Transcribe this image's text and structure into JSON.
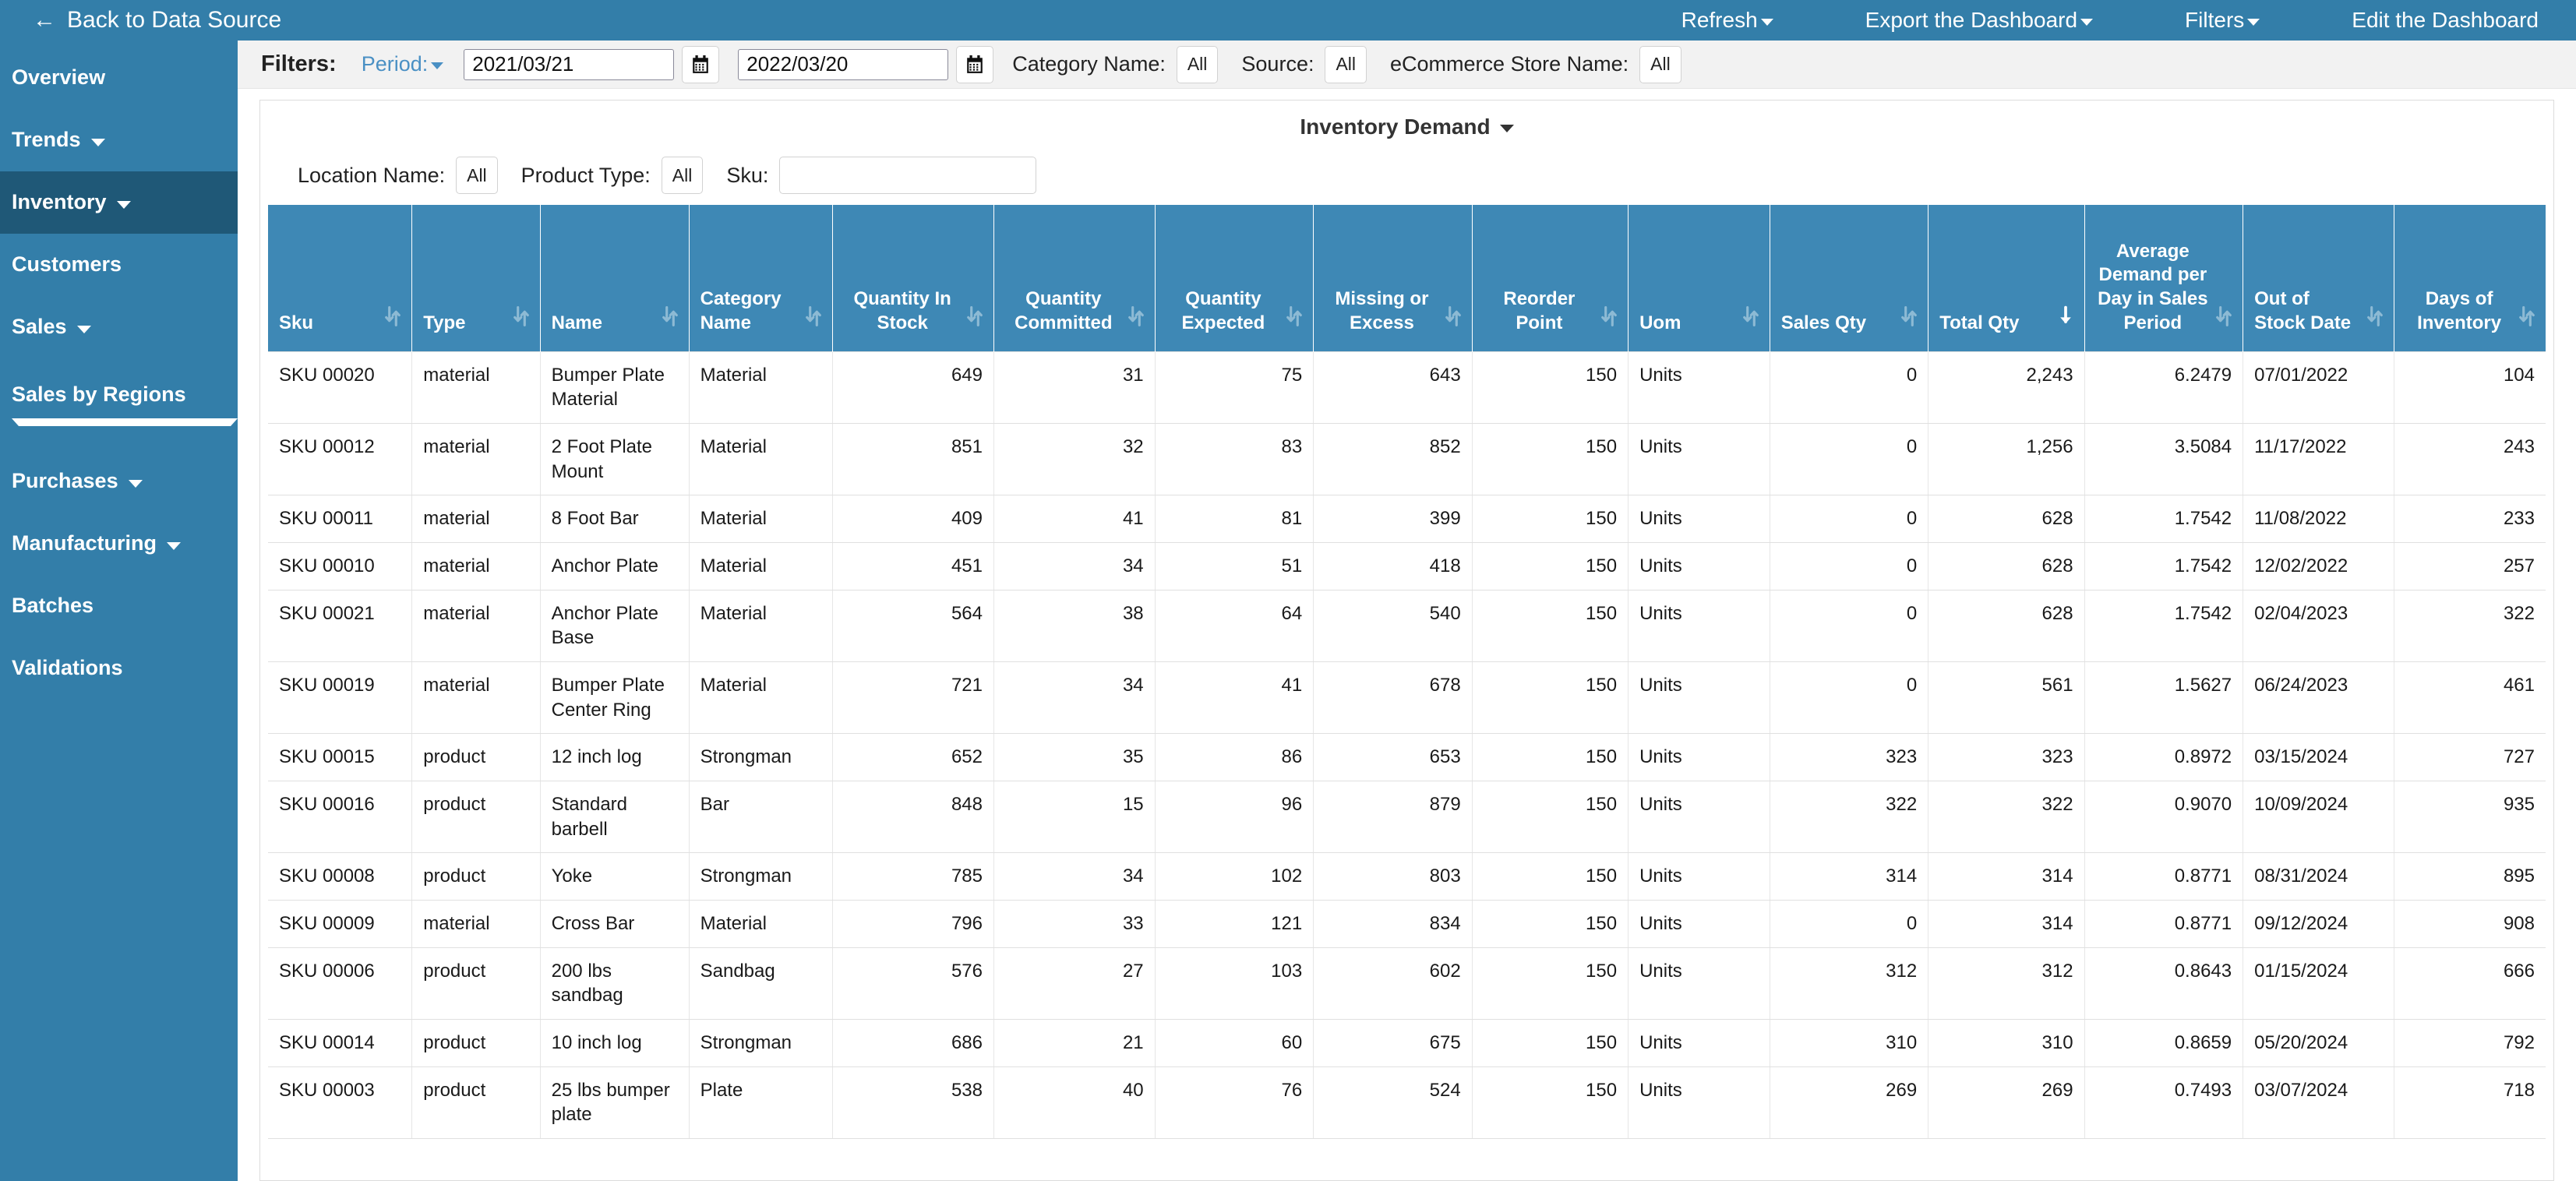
{
  "topbar": {
    "back_label": "Back to Data Source",
    "back_icon": "arrow-left-icon",
    "nav": [
      {
        "label": "Refresh",
        "has_caret": true
      },
      {
        "label": "Export the Dashboard",
        "has_caret": true
      },
      {
        "label": "Filters",
        "has_caret": true
      },
      {
        "label": "Edit the Dashboard",
        "has_caret": false
      }
    ]
  },
  "sidebar": {
    "items": [
      {
        "label": "Overview",
        "caret": false,
        "active": false
      },
      {
        "label": "Trends",
        "caret": true,
        "active": false
      },
      {
        "label": "Inventory",
        "caret": true,
        "active": true
      },
      {
        "label": "Customers",
        "caret": false,
        "active": false
      },
      {
        "label": "Sales",
        "caret": true,
        "active": false
      },
      {
        "label": "Sales by Regions",
        "caret": true,
        "active": false,
        "wrapped": true
      },
      {
        "label": "Purchases",
        "caret": true,
        "active": false
      },
      {
        "label": "Manufacturing",
        "caret": true,
        "active": false
      },
      {
        "label": "Batches",
        "caret": false,
        "active": false
      },
      {
        "label": "Validations",
        "caret": false,
        "active": false
      }
    ]
  },
  "filterbar": {
    "title": "Filters:",
    "period_label": "Period:",
    "date_from": "2021/03/21",
    "date_to": "2022/03/20",
    "calendar_icon": "calendar-icon",
    "category_label": "Category Name:",
    "category_value": "All",
    "source_label": "Source:",
    "source_value": "All",
    "store_label": "eCommerce Store Name:",
    "store_value": "All"
  },
  "panel": {
    "title": "Inventory Demand",
    "location_label": "Location Name:",
    "location_value": "All",
    "product_type_label": "Product Type:",
    "product_type_value": "All",
    "sku_label": "Sku:",
    "sku_value": "",
    "sku_placeholder": ""
  },
  "table": {
    "sort_column": "Total Qty",
    "sort_direction": "desc",
    "columns": [
      {
        "label": "Sku",
        "align": "txt",
        "sorted": false
      },
      {
        "label": "Type",
        "align": "txt",
        "sorted": false
      },
      {
        "label": "Name",
        "align": "txt",
        "sorted": false
      },
      {
        "label": "Category Name",
        "align": "txt",
        "sorted": false
      },
      {
        "label": "Quantity In Stock",
        "align": "num",
        "sorted": false
      },
      {
        "label": "Quantity Committed",
        "align": "num",
        "sorted": false
      },
      {
        "label": "Quantity Expected",
        "align": "num",
        "sorted": false
      },
      {
        "label": "Missing or Excess",
        "align": "num",
        "sorted": false
      },
      {
        "label": "Reorder Point",
        "align": "num",
        "sorted": false
      },
      {
        "label": "Uom",
        "align": "txt",
        "sorted": false
      },
      {
        "label": "Sales Qty",
        "align": "num",
        "sorted": false
      },
      {
        "label": "Total Qty",
        "align": "num",
        "sorted": true
      },
      {
        "label": "Average Demand per Day in Sales Period",
        "align": "num",
        "sorted": false
      },
      {
        "label": "Out of Stock Date",
        "align": "txt",
        "sorted": false
      },
      {
        "label": "Days of Inventory",
        "align": "num",
        "sorted": false
      }
    ],
    "rows": [
      [
        "SKU 00020",
        "material",
        "Bumper Plate Material",
        "Material",
        "649",
        "31",
        "75",
        "643",
        "150",
        "Units",
        "0",
        "2,243",
        "6.2479",
        "07/01/2022",
        "104"
      ],
      [
        "SKU 00012",
        "material",
        "2 Foot Plate Mount",
        "Material",
        "851",
        "32",
        "83",
        "852",
        "150",
        "Units",
        "0",
        "1,256",
        "3.5084",
        "11/17/2022",
        "243"
      ],
      [
        "SKU 00011",
        "material",
        "8 Foot Bar",
        "Material",
        "409",
        "41",
        "81",
        "399",
        "150",
        "Units",
        "0",
        "628",
        "1.7542",
        "11/08/2022",
        "233"
      ],
      [
        "SKU 00010",
        "material",
        "Anchor Plate",
        "Material",
        "451",
        "34",
        "51",
        "418",
        "150",
        "Units",
        "0",
        "628",
        "1.7542",
        "12/02/2022",
        "257"
      ],
      [
        "SKU 00021",
        "material",
        "Anchor Plate Base",
        "Material",
        "564",
        "38",
        "64",
        "540",
        "150",
        "Units",
        "0",
        "628",
        "1.7542",
        "02/04/2023",
        "322"
      ],
      [
        "SKU 00019",
        "material",
        "Bumper Plate Center Ring",
        "Material",
        "721",
        "34",
        "41",
        "678",
        "150",
        "Units",
        "0",
        "561",
        "1.5627",
        "06/24/2023",
        "461"
      ],
      [
        "SKU 00015",
        "product",
        "12 inch log",
        "Strongman",
        "652",
        "35",
        "86",
        "653",
        "150",
        "Units",
        "323",
        "323",
        "0.8972",
        "03/15/2024",
        "727"
      ],
      [
        "SKU 00016",
        "product",
        "Standard barbell",
        "Bar",
        "848",
        "15",
        "96",
        "879",
        "150",
        "Units",
        "322",
        "322",
        "0.9070",
        "10/09/2024",
        "935"
      ],
      [
        "SKU 00008",
        "product",
        "Yoke",
        "Strongman",
        "785",
        "34",
        "102",
        "803",
        "150",
        "Units",
        "314",
        "314",
        "0.8771",
        "08/31/2024",
        "895"
      ],
      [
        "SKU 00009",
        "material",
        "Cross Bar",
        "Material",
        "796",
        "33",
        "121",
        "834",
        "150",
        "Units",
        "0",
        "314",
        "0.8771",
        "09/12/2024",
        "908"
      ],
      [
        "SKU 00006",
        "product",
        "200 lbs sandbag",
        "Sandbag",
        "576",
        "27",
        "103",
        "602",
        "150",
        "Units",
        "312",
        "312",
        "0.8643",
        "01/15/2024",
        "666"
      ],
      [
        "SKU 00014",
        "product",
        "10 inch log",
        "Strongman",
        "686",
        "21",
        "60",
        "675",
        "150",
        "Units",
        "310",
        "310",
        "0.8659",
        "05/20/2024",
        "792"
      ],
      [
        "SKU 00003",
        "product",
        "25 lbs bumper plate",
        "Plate",
        "538",
        "40",
        "76",
        "524",
        "150",
        "Units",
        "269",
        "269",
        "0.7493",
        "03/07/2024",
        "718"
      ]
    ]
  },
  "colors": {
    "brand_blue": "#337ea9",
    "sidebar_active": "#1f5877",
    "table_header": "#3e88b5",
    "filter_bg": "#f2f2f2",
    "link_blue": "#4a90c4"
  }
}
